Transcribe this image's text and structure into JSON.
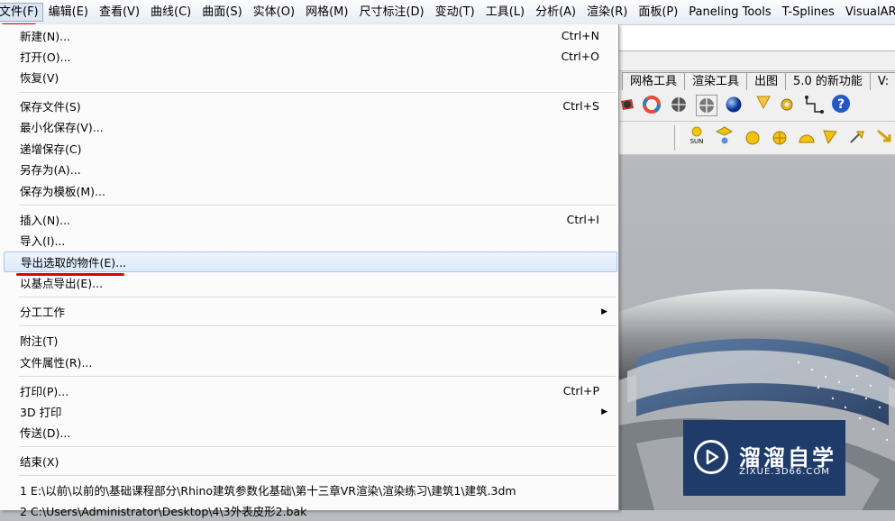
{
  "menubar": {
    "items": [
      "文件(F)",
      "编辑(E)",
      "查看(V)",
      "曲线(C)",
      "曲面(S)",
      "实体(O)",
      "网格(M)",
      "尺寸标注(D)",
      "变动(T)",
      "工具(L)",
      "分析(A)",
      "渲染(R)",
      "面板(P)",
      "Paneling Tools",
      "T-Splines",
      "VisualAR"
    ]
  },
  "toolbar_tabs": [
    "网格工具",
    "渲染工具",
    "出图",
    "5.0 的新功能",
    "V:"
  ],
  "toolbar_icons_row1": [
    "camera-icon",
    "color-wheel-icon",
    "sphere-icon",
    "sphere-outline-icon",
    "blue-sphere-icon",
    "spotlight-icon",
    "gear-icon",
    "dimension-icon",
    "help-icon"
  ],
  "toolbar_icons_row2": [
    "sun-icon",
    "directional-light-icon",
    "point-light-icon",
    "sphere-light-icon",
    "dome-light-icon",
    "spot-light-icon",
    "wand-icon",
    "arrow-light-icon"
  ],
  "toolbar_sun_label": "SUN",
  "file_menu": {
    "items": [
      {
        "label": "新建(N)...",
        "shortcut": "Ctrl+N"
      },
      {
        "label": "打开(O)...",
        "shortcut": "Ctrl+O"
      },
      {
        "label": "恢复(V)",
        "shortcut": ""
      },
      {
        "label": "保存文件(S)",
        "shortcut": "Ctrl+S"
      },
      {
        "label": "最小化保存(V)...",
        "shortcut": ""
      },
      {
        "label": "递增保存(C)",
        "shortcut": ""
      },
      {
        "label": "另存为(A)...",
        "shortcut": ""
      },
      {
        "label": "保存为模板(M)...",
        "shortcut": ""
      },
      {
        "label": "插入(N)...",
        "shortcut": "Ctrl+I"
      },
      {
        "label": "导入(I)...",
        "shortcut": ""
      },
      {
        "label": "导出选取的物件(E)...",
        "shortcut": ""
      },
      {
        "label": "以基点导出(E)...",
        "shortcut": ""
      },
      {
        "label": "分工工作",
        "shortcut": ""
      },
      {
        "label": "附注(T)",
        "shortcut": ""
      },
      {
        "label": "文件属性(R)...",
        "shortcut": ""
      },
      {
        "label": "打印(P)...",
        "shortcut": "Ctrl+P"
      },
      {
        "label": "3D 打印",
        "shortcut": ""
      },
      {
        "label": "传送(D)...",
        "shortcut": ""
      },
      {
        "label": "结束(X)",
        "shortcut": ""
      },
      {
        "label": "1 E:\\以前\\以前的\\基础课程部分\\Rhino建筑参数化基础\\第十三章VR渲染\\渲染练习\\建筑1\\建筑.3dm",
        "shortcut": ""
      },
      {
        "label": "2 C:\\Users\\Administrator\\Desktop\\4\\3外表皮形2.bak",
        "shortcut": ""
      }
    ],
    "submenu_arrow": "▶"
  },
  "watermark": {
    "title": "溜溜自学",
    "url": "ZIXUE.3D66.COM"
  },
  "colors": {
    "highlight": "#dbe9fa",
    "annotation_red": "#e00000",
    "watermark_bg": "#1f3b6a"
  }
}
